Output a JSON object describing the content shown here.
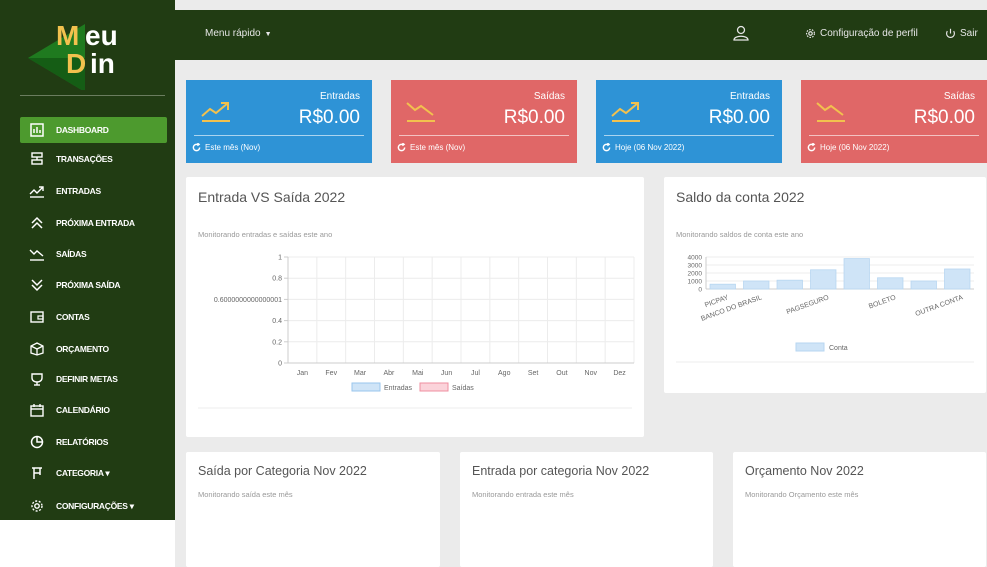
{
  "logo": {
    "line1": "eu",
    "line2": "in",
    "letter_m": "M",
    "letter_d": "D"
  },
  "sidebar": {
    "items": [
      {
        "label": "DASHBOARD",
        "icon": "dashboard-icon",
        "active": true
      },
      {
        "label": "TRANSAÇÕES",
        "icon": "transactions-icon"
      },
      {
        "label": "ENTRADAS",
        "icon": "trend-up-icon"
      },
      {
        "label": "PRÓXIMA ENTRADA",
        "icon": "double-chevron-up-icon"
      },
      {
        "label": "SAÍDAS",
        "icon": "trend-down-icon"
      },
      {
        "label": "PRÓXIMA SAÍDA",
        "icon": "double-chevron-down-icon"
      },
      {
        "label": "CONTAS",
        "icon": "wallet-icon"
      },
      {
        "label": "ORÇAMENTO",
        "icon": "box-icon"
      },
      {
        "label": "DEFINIR METAS",
        "icon": "trophy-icon"
      },
      {
        "label": "CALENDÁRIO",
        "icon": "calendar-icon"
      },
      {
        "label": "RELATÓRIOS",
        "icon": "pie-chart-icon"
      },
      {
        "label": "CATEGORIA ▾",
        "icon": "category-icon"
      },
      {
        "label": "CONFIGURAÇÕES ▾",
        "icon": "gear-icon"
      }
    ]
  },
  "topbar": {
    "menu_rapido": "Menu rápido",
    "config_perfil": "Configuração de perfil",
    "sair": "Sair"
  },
  "cards": [
    {
      "title": "Entradas",
      "value": "R$0.00",
      "footer": "Este mês (Nov)",
      "color": "#2e93d6",
      "icon": "trend-up-icon"
    },
    {
      "title": "Saídas",
      "value": "R$0.00",
      "footer": "Este mês (Nov)",
      "color": "#e06767",
      "icon": "trend-down-icon"
    },
    {
      "title": "Entradas",
      "value": "R$0.00",
      "footer": "Hoje (06 Nov 2022)",
      "color": "#2e93d6",
      "icon": "trend-up-icon"
    },
    {
      "title": "Saídas",
      "value": "R$0.00",
      "footer": "Hoje (06 Nov 2022)",
      "color": "#e06767",
      "icon": "trend-down-icon"
    }
  ],
  "panels": {
    "entrada_saida": {
      "title": "Entrada VS Saída 2022",
      "subtitle": "Monitorando entradas e saídas este ano"
    },
    "saldo": {
      "title": "Saldo da conta 2022",
      "subtitle": "Monitorando saldos de conta este ano"
    },
    "saida_cat": {
      "title": "Saída por Categoria Nov 2022",
      "subtitle": "Monitorando saída este mês"
    },
    "entrada_cat": {
      "title": "Entrada por categoria Nov 2022",
      "subtitle": "Monitorando entrada este mês"
    },
    "orcamento": {
      "title": "Orçamento Nov 2022",
      "subtitle": "Monitorando Orçamento este mês"
    }
  },
  "chart_data": [
    {
      "type": "line",
      "categories": [
        "Jan",
        "Fev",
        "Mar",
        "Abr",
        "Mai",
        "Jun",
        "Jul",
        "Ago",
        "Set",
        "Out",
        "Nov",
        "Dez"
      ],
      "y_ticks": [
        "1",
        "0.8",
        "0.6000000000000001",
        "0.4",
        "0.2",
        "0"
      ],
      "ylim": [
        0,
        1
      ],
      "series": [
        {
          "name": "Entradas",
          "values": [],
          "color": "#cfe4f7",
          "border": "#9ac6ec"
        },
        {
          "name": "Saídas",
          "values": [],
          "color": "#fbd3da",
          "border": "#ef8fa0"
        }
      ],
      "grid": true,
      "legend": "bottom"
    },
    {
      "type": "bar",
      "categories": [
        "PICPAY",
        "BANCO DO BRASIL",
        "",
        "PAGSEGURO",
        "",
        "BOLETO",
        "",
        "OUTRA CONTA"
      ],
      "y_ticks": [
        "4000",
        "3000",
        "2000",
        "1000",
        "0"
      ],
      "ylim": [
        0,
        4000
      ],
      "series": [
        {
          "name": "Conta",
          "values": [
            600,
            1000,
            1100,
            2400,
            3800,
            1400,
            1000,
            2500
          ],
          "color": "#cfe4f7"
        }
      ],
      "grid": true,
      "legend": "bottom"
    }
  ]
}
